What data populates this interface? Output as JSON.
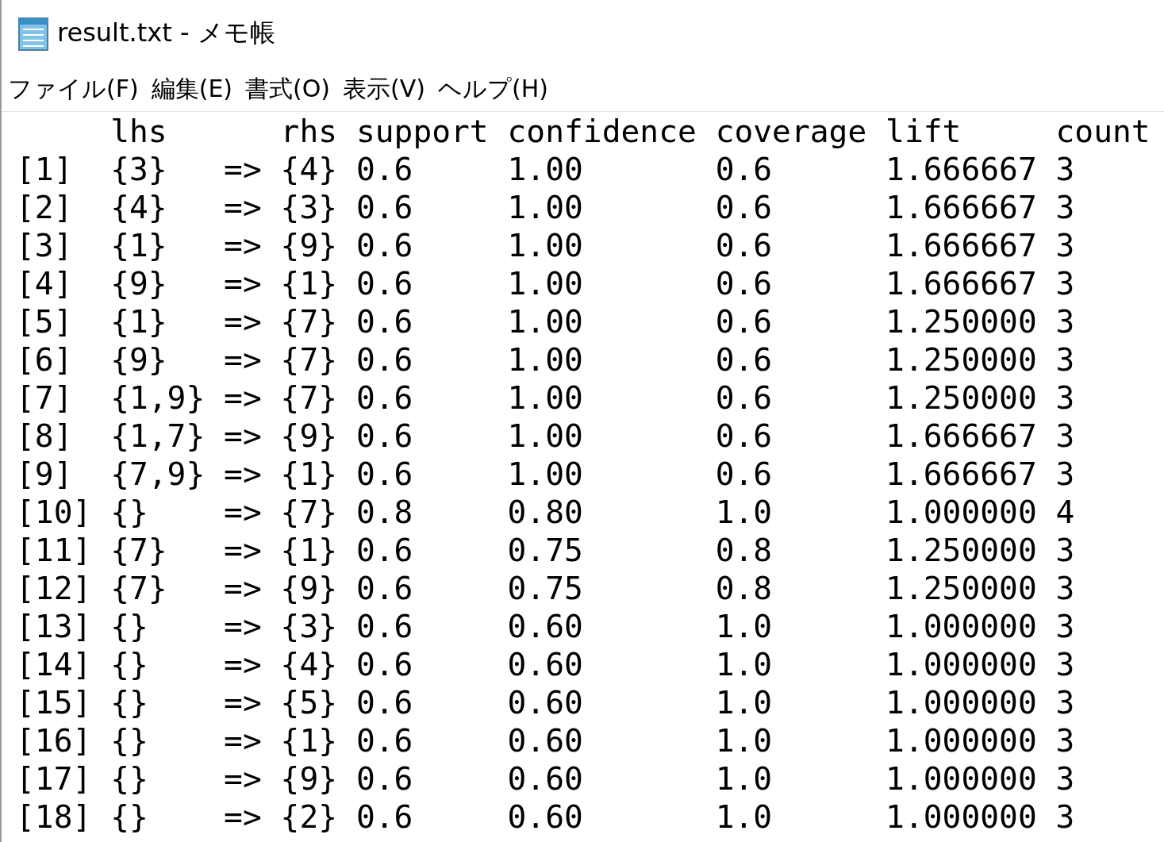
{
  "window": {
    "title": "result.txt - メモ帳"
  },
  "menu": [
    "ファイル(F)",
    "編集(E)",
    "書式(O)",
    "表示(V)",
    "ヘルプ(H)"
  ],
  "editor": {
    "lines": [
      "     lhs      rhs support confidence coverage lift     count",
      "[1]  {3}   => {4} 0.6     1.00       0.6      1.666667 3",
      "[2]  {4}   => {3} 0.6     1.00       0.6      1.666667 3",
      "[3]  {1}   => {9} 0.6     1.00       0.6      1.666667 3",
      "[4]  {9}   => {1} 0.6     1.00       0.6      1.666667 3",
      "[5]  {1}   => {7} 0.6     1.00       0.6      1.250000 3",
      "[6]  {9}   => {7} 0.6     1.00       0.6      1.250000 3",
      "[7]  {1,9} => {7} 0.6     1.00       0.6      1.250000 3",
      "[8]  {1,7} => {9} 0.6     1.00       0.6      1.666667 3",
      "[9]  {7,9} => {1} 0.6     1.00       0.6      1.666667 3",
      "[10] {}    => {7} 0.8     0.80       1.0      1.000000 4",
      "[11] {7}   => {1} 0.6     0.75       0.8      1.250000 3",
      "[12] {7}   => {9} 0.6     0.75       0.8      1.250000 3",
      "[13] {}    => {3} 0.6     0.60       1.0      1.000000 3",
      "[14] {}    => {4} 0.6     0.60       1.0      1.000000 3",
      "[15] {}    => {5} 0.6     0.60       1.0      1.000000 3",
      "[16] {}    => {1} 0.6     0.60       1.0      1.000000 3",
      "[17] {}    => {9} 0.6     0.60       1.0      1.000000 3",
      "[18] {}    => {2} 0.6     0.60       1.0      1.000000 3"
    ]
  }
}
